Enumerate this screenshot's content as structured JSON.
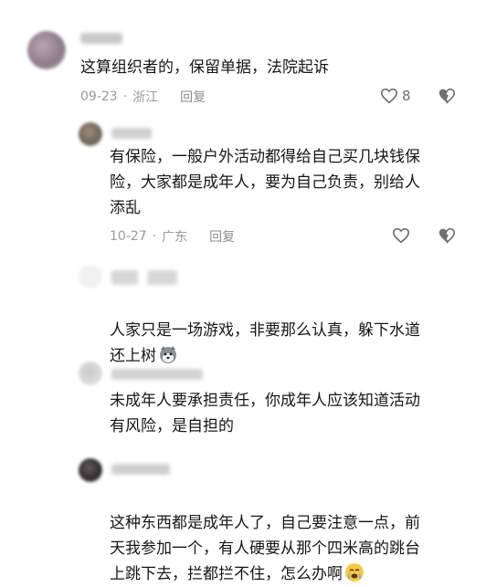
{
  "comments": [
    {
      "text": "这算组织者的，保留单据，法院起诉",
      "date": "09-23",
      "location": "浙江",
      "reply_label": "回复",
      "likes": "8"
    },
    {
      "text": "有保险，一般户外活动都得给自己买几块钱保\n险，大家都是成年人，要为自己负责，别给人\n添乱",
      "date": "10-27",
      "location": "广东",
      "reply_label": "回复"
    },
    {
      "text": "人家只是一场游戏，非要那么认真，躲下水道\n还上树",
      "emoji": "husky-face-emoji"
    },
    {
      "text": "未成年人要承担责任，你成年人应该知道活动\n有风险，是自担的"
    },
    {
      "text": "这种东西都是成年人了，自己要注意一点，前\n天我参加一个，有人硬要从那个四米高的跳台\n上跳下去，拦都拦不住，怎么办啊",
      "emoji": "crying-face-emoji"
    }
  ],
  "icons": {
    "like": "heart-outline-icon",
    "dislike": "broken-heart-icon"
  },
  "colors": {
    "text": "#161616",
    "meta": "#9a9a9a",
    "icon": "#707070"
  }
}
